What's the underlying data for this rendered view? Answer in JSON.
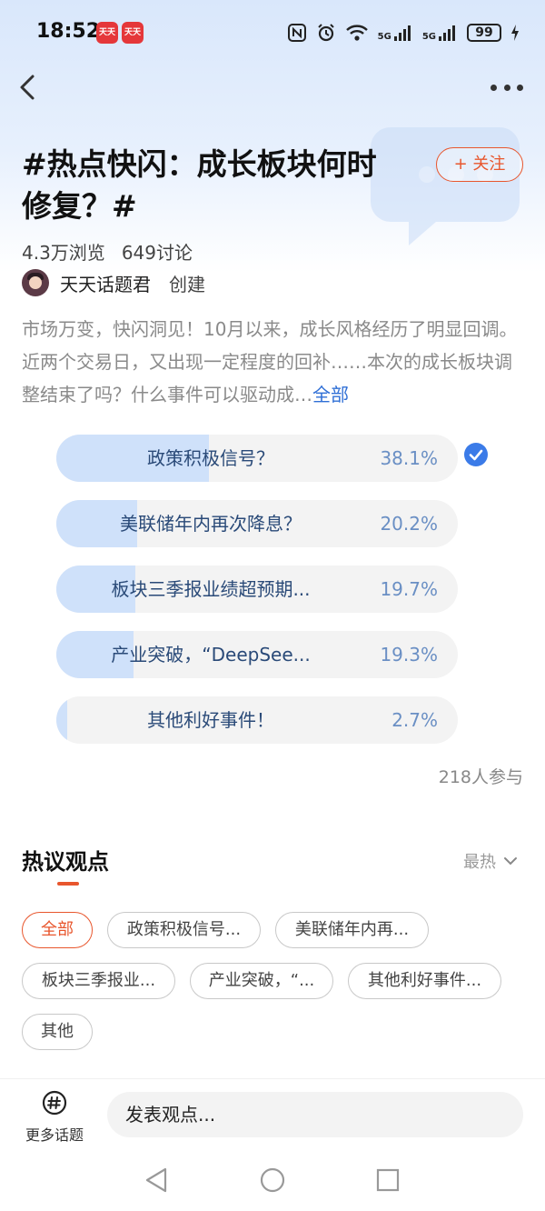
{
  "status_bar": {
    "time": "18:52",
    "app_badges": [
      "天天",
      "天天"
    ],
    "network": [
      "5G",
      "5G"
    ],
    "battery": "99"
  },
  "topic": {
    "title": "#热点快闪：成长板块何时修复？#",
    "follow_label": "+ 关注",
    "views": "4.3万浏览",
    "discussions": "649讨论",
    "creator_name": "天天话题君",
    "creator_role": "创建",
    "description": "市场万变，快闪洞见！10月以来，成长风格经历了明显回调。近两个交易日，又出现一定程度的回补……本次的成长板块调整结束了吗？什么事件可以驱动成…",
    "description_more": "全部"
  },
  "poll": {
    "options": [
      {
        "label": "政策积极信号？",
        "percent": "38.1%",
        "value": 38.1,
        "selected": true
      },
      {
        "label": "美联储年内再次降息？",
        "percent": "20.2%",
        "value": 20.2,
        "selected": false
      },
      {
        "label": "板块三季报业绩超预期...",
        "percent": "19.7%",
        "value": 19.7,
        "selected": false
      },
      {
        "label": "产业突破，“DeepSee...",
        "percent": "19.3%",
        "value": 19.3,
        "selected": false
      },
      {
        "label": "其他利好事件！",
        "percent": "2.7%",
        "value": 2.7,
        "selected": false
      }
    ],
    "participants": "218人参与"
  },
  "hot": {
    "title": "热议观点",
    "sort_label": "最热",
    "chips": [
      "全部",
      "政策积极信号...",
      "美联储年内再...",
      "板块三季报业...",
      "产业突破，“...",
      "其他利好事件...",
      "其他"
    ],
    "active_chip": "全部"
  },
  "bottom": {
    "more_topics": "更多话题",
    "input_placeholder": "发表观点..."
  },
  "colors": {
    "accent": "#e8562d",
    "poll_fill": "#cfe1fa",
    "poll_text": "#2a4a78",
    "link": "#2f6fd6",
    "check": "#3b7be8"
  },
  "icons": [
    "back-arrow-icon",
    "more-dots-icon",
    "check-circle-icon",
    "chevron-down-icon",
    "hashtag-bubble-icon",
    "nav-back-icon",
    "nav-home-icon",
    "nav-recent-icon"
  ]
}
